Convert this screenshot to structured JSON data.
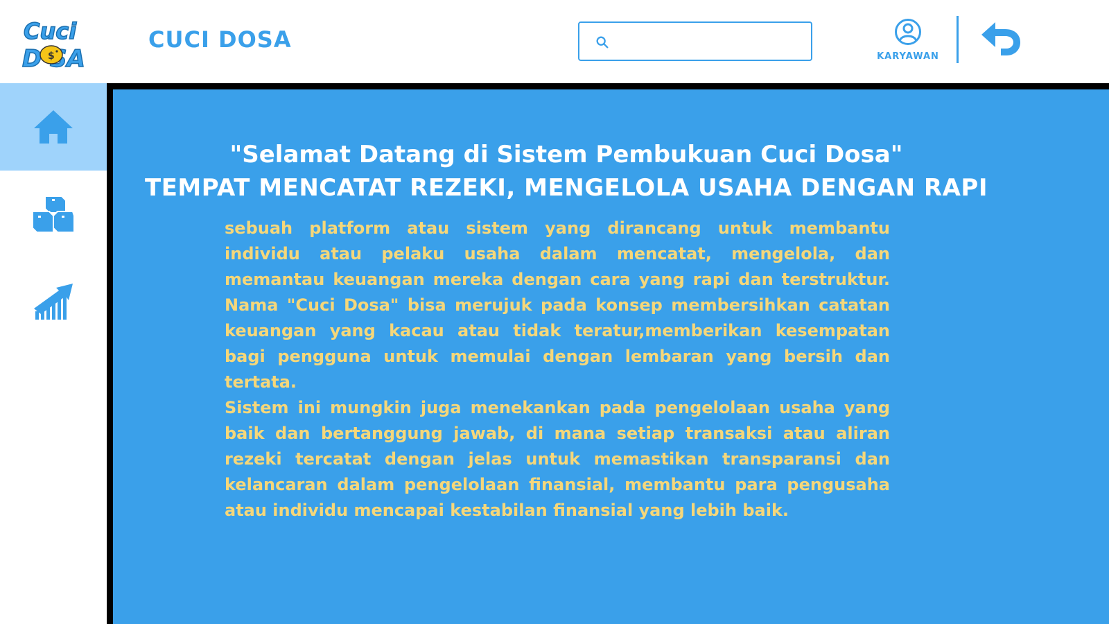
{
  "header": {
    "brand_title": "CUCI DOSA",
    "logo_text": "Cuci Dosa",
    "search": {
      "value": "",
      "placeholder": ""
    },
    "user_label": "KARYAWAN"
  },
  "sidebar": {
    "items": [
      {
        "name": "home",
        "icon": "home-icon",
        "active": true
      },
      {
        "name": "inventory",
        "icon": "boxes-icon",
        "active": false
      },
      {
        "name": "reports",
        "icon": "chart-growth-icon",
        "active": false
      }
    ]
  },
  "main": {
    "title_line1": "\"Selamat Datang di Sistem Pembukuan Cuci Dosa\"",
    "title_line2": "TEMPAT MENCATAT REZEKI, MENGELOLA USAHA DENGAN RAPI",
    "paragraph1": "sebuah platform atau sistem yang dirancang untuk membantu individu atau pelaku usaha dalam mencatat, mengelola, dan memantau keuangan mereka dengan cara yang rapi dan terstruktur. Nama \"Cuci Dosa\" bisa merujuk pada konsep membersihkan catatan keuangan yang kacau atau tidak teratur,memberikan kesempatan bagi pengguna untuk memulai dengan lembaran yang bersih dan tertata.",
    "paragraph2": "Sistem ini mungkin juga menekankan pada pengelolaan usaha yang baik dan bertanggung jawab, di mana setiap transaksi atau aliran rezeki tercatat dengan jelas untuk memastikan transparansi dan kelancaran dalam pengelolaan finansial, membantu para pengusaha atau individu mencapai kestabilan finansial yang lebih baik."
  },
  "colors": {
    "accent": "#3aa0ea",
    "active_nav": "#9fd3fb",
    "title_text": "#ffffff",
    "body_text": "#f5d77a",
    "coin": "#f5c518"
  }
}
